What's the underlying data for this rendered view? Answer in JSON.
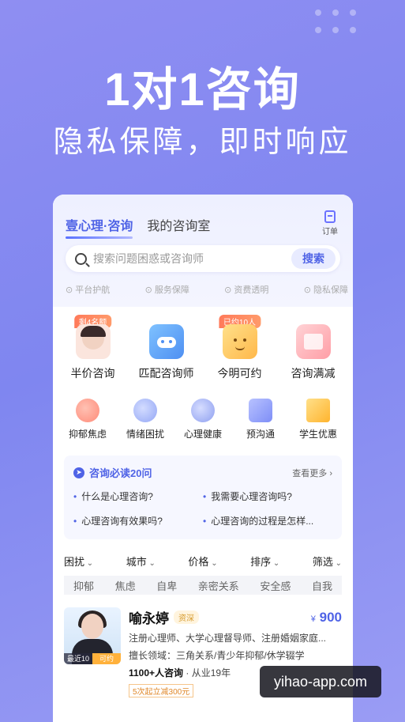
{
  "hero": {
    "title": "1对1咨询",
    "subtitle": "隐私保障，即时响应"
  },
  "header": {
    "tab_main": "壹心理·咨询",
    "tab_room": "我的咨询室",
    "order_label": "订单"
  },
  "search": {
    "placeholder": "搜索问题困惑或咨询师",
    "button": "搜索"
  },
  "guarantees": [
    "平台护航",
    "服务保障",
    "资费透明",
    "隐私保障"
  ],
  "quick": [
    {
      "label": "半价咨询",
      "badge": "剩4名额",
      "icon": "half-price-consult-icon",
      "color": "#fbe5dd"
    },
    {
      "label": "匹配咨询师",
      "badge": "",
      "icon": "match-counselor-icon",
      "color": "#5aa9f7"
    },
    {
      "label": "今明可约",
      "badge": "已约10人",
      "icon": "today-tomorrow-icon",
      "color": "#ffcc6a"
    },
    {
      "label": "咨询满减",
      "badge": "",
      "icon": "consult-discount-icon",
      "color": "#ffc0c6"
    }
  ],
  "categories": [
    {
      "label": "抑郁焦虑",
      "icon": "depression-anxiety-icon",
      "color": "#ff9a8a"
    },
    {
      "label": "情绪困扰",
      "icon": "emotion-trouble-icon",
      "color": "#a6b8ff"
    },
    {
      "label": "心理健康",
      "icon": "mental-health-icon",
      "color": "#9fb0f6"
    },
    {
      "label": "预沟通",
      "icon": "pre-communication-icon",
      "color": "#8f9cff"
    },
    {
      "label": "学生优惠",
      "icon": "student-discount-icon",
      "color": "#ffc34d"
    }
  ],
  "faq": {
    "title": "咨询必读20问",
    "more": "查看更多 ›",
    "questions": [
      "什么是心理咨询?",
      "我需要心理咨询吗?",
      "心理咨询有效果吗?",
      "心理咨询的过程是怎样..."
    ]
  },
  "filters": [
    "困扰",
    "城市",
    "价格",
    "排序",
    "筛选"
  ],
  "tags": [
    "抑郁",
    "焦虑",
    "自卑",
    "亲密关系",
    "安全感",
    "自我"
  ],
  "counselor": {
    "name": "喻永婷",
    "level": "资深",
    "price_symbol": "¥",
    "price": "900",
    "title_line": "注册心理师、大学心理督导师、注册婚姻家庭...",
    "field_line": "擅长领域：三角关系/青少年抑郁/休学辍学",
    "consult_count": "1100+人咨询",
    "years": "· 从业19年",
    "promo": "5次起立减300元",
    "avatar_badge_left": "最近10天",
    "avatar_badge_right": "可约"
  },
  "watermark": "yihao-app.com"
}
